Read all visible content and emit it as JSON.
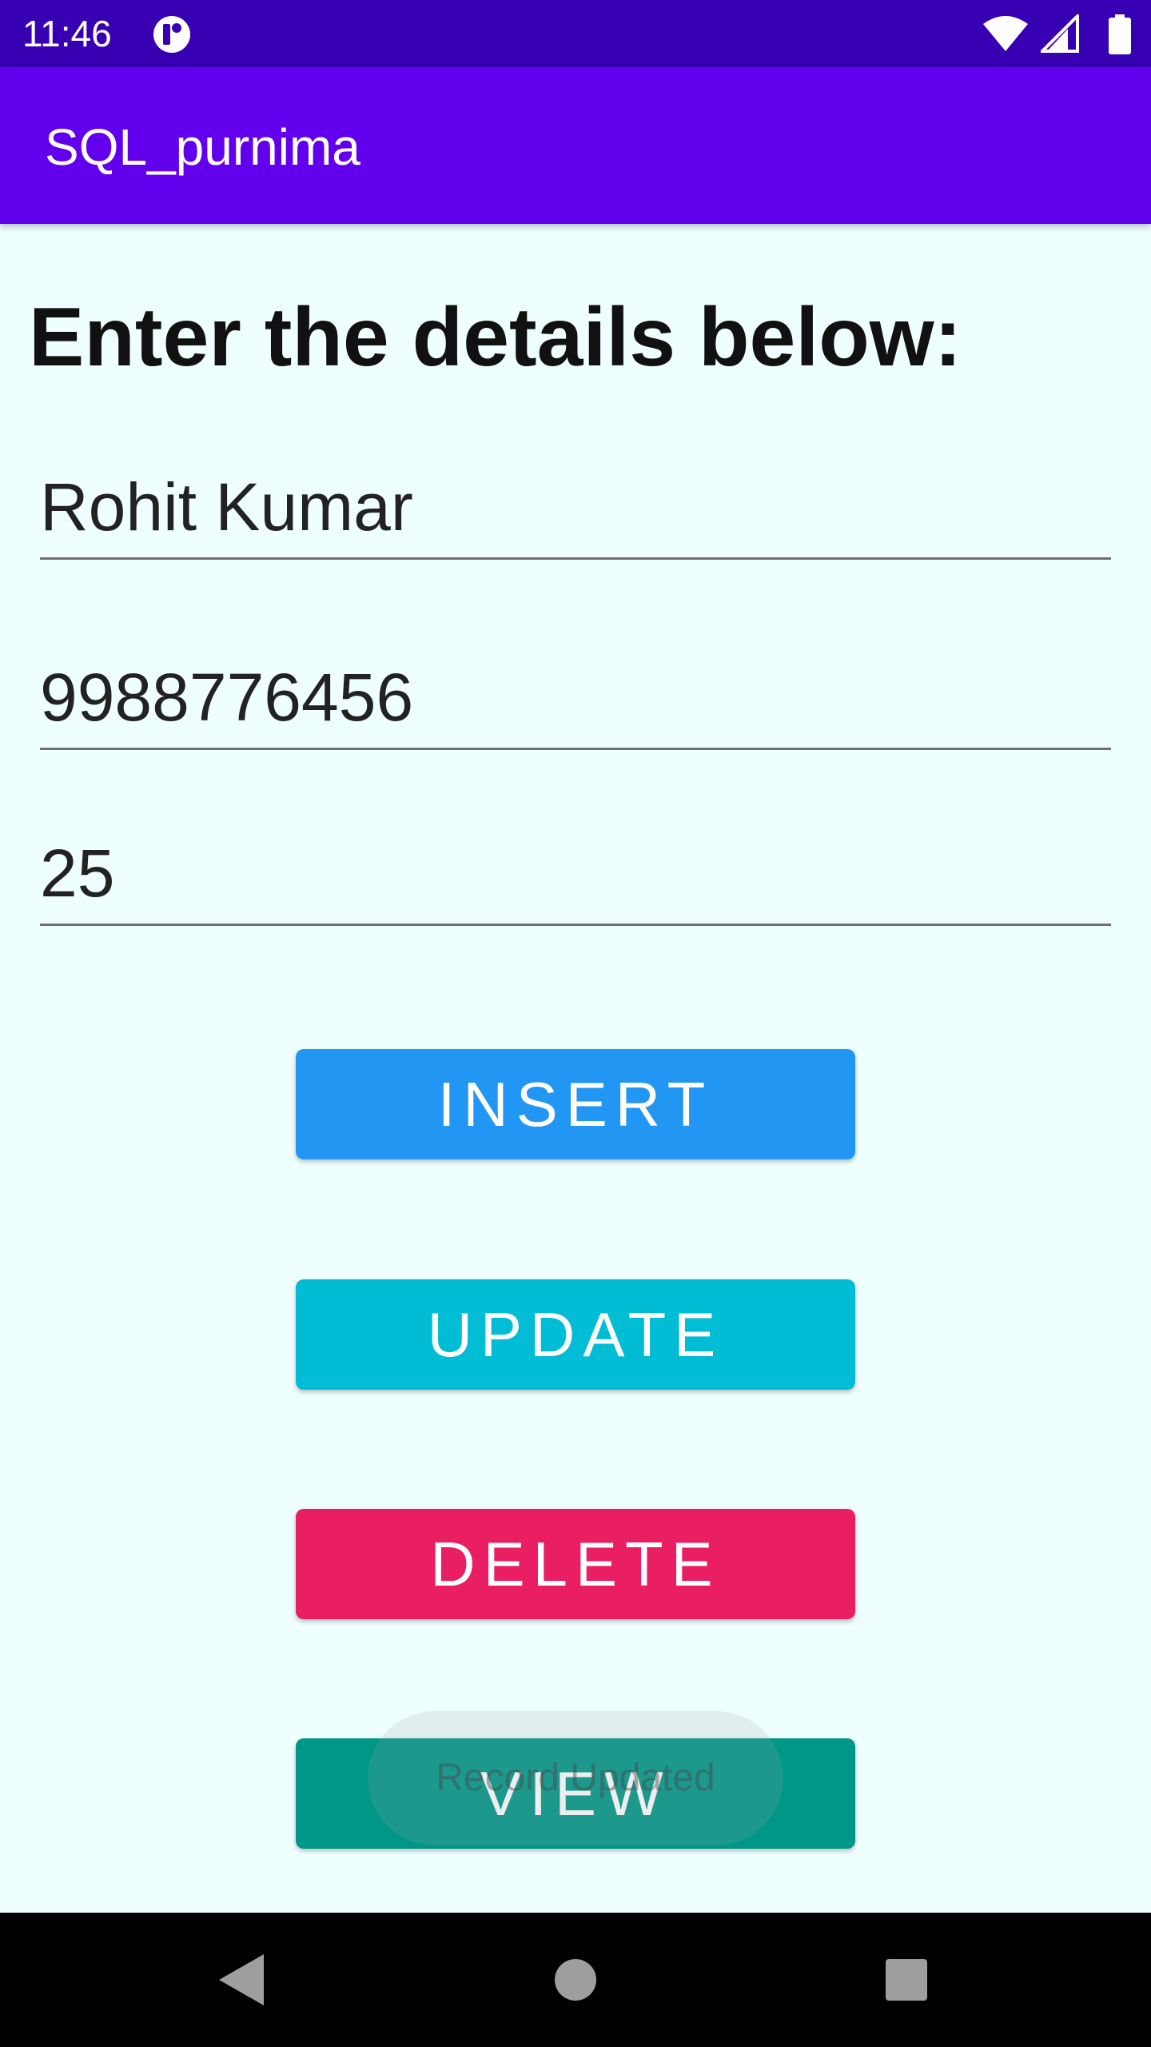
{
  "status_bar": {
    "time": "11:46",
    "icons": [
      "app-notification-icon",
      "wifi-icon",
      "cellular-icon",
      "battery-icon"
    ]
  },
  "app_bar": {
    "title": "SQL_purnima"
  },
  "form": {
    "heading": "Enter the details below:",
    "name_value": "Rohit Kumar",
    "contact_value": "9988776456",
    "age_value": "25"
  },
  "buttons": {
    "insert": "INSERT",
    "update": "UPDATE",
    "delete": "DELETE",
    "view": "VIEW"
  },
  "toast": {
    "message": "Record Updated"
  },
  "colors": {
    "status_bar": "#3700B3",
    "app_bar": "#6200EE",
    "background": "#EFFFFF",
    "insert": "#2196F3",
    "update": "#00BCD4",
    "delete": "#E91E63",
    "view": "#009688"
  },
  "nav_bar": {
    "icons": [
      "back-icon",
      "home-icon",
      "recents-icon"
    ]
  }
}
